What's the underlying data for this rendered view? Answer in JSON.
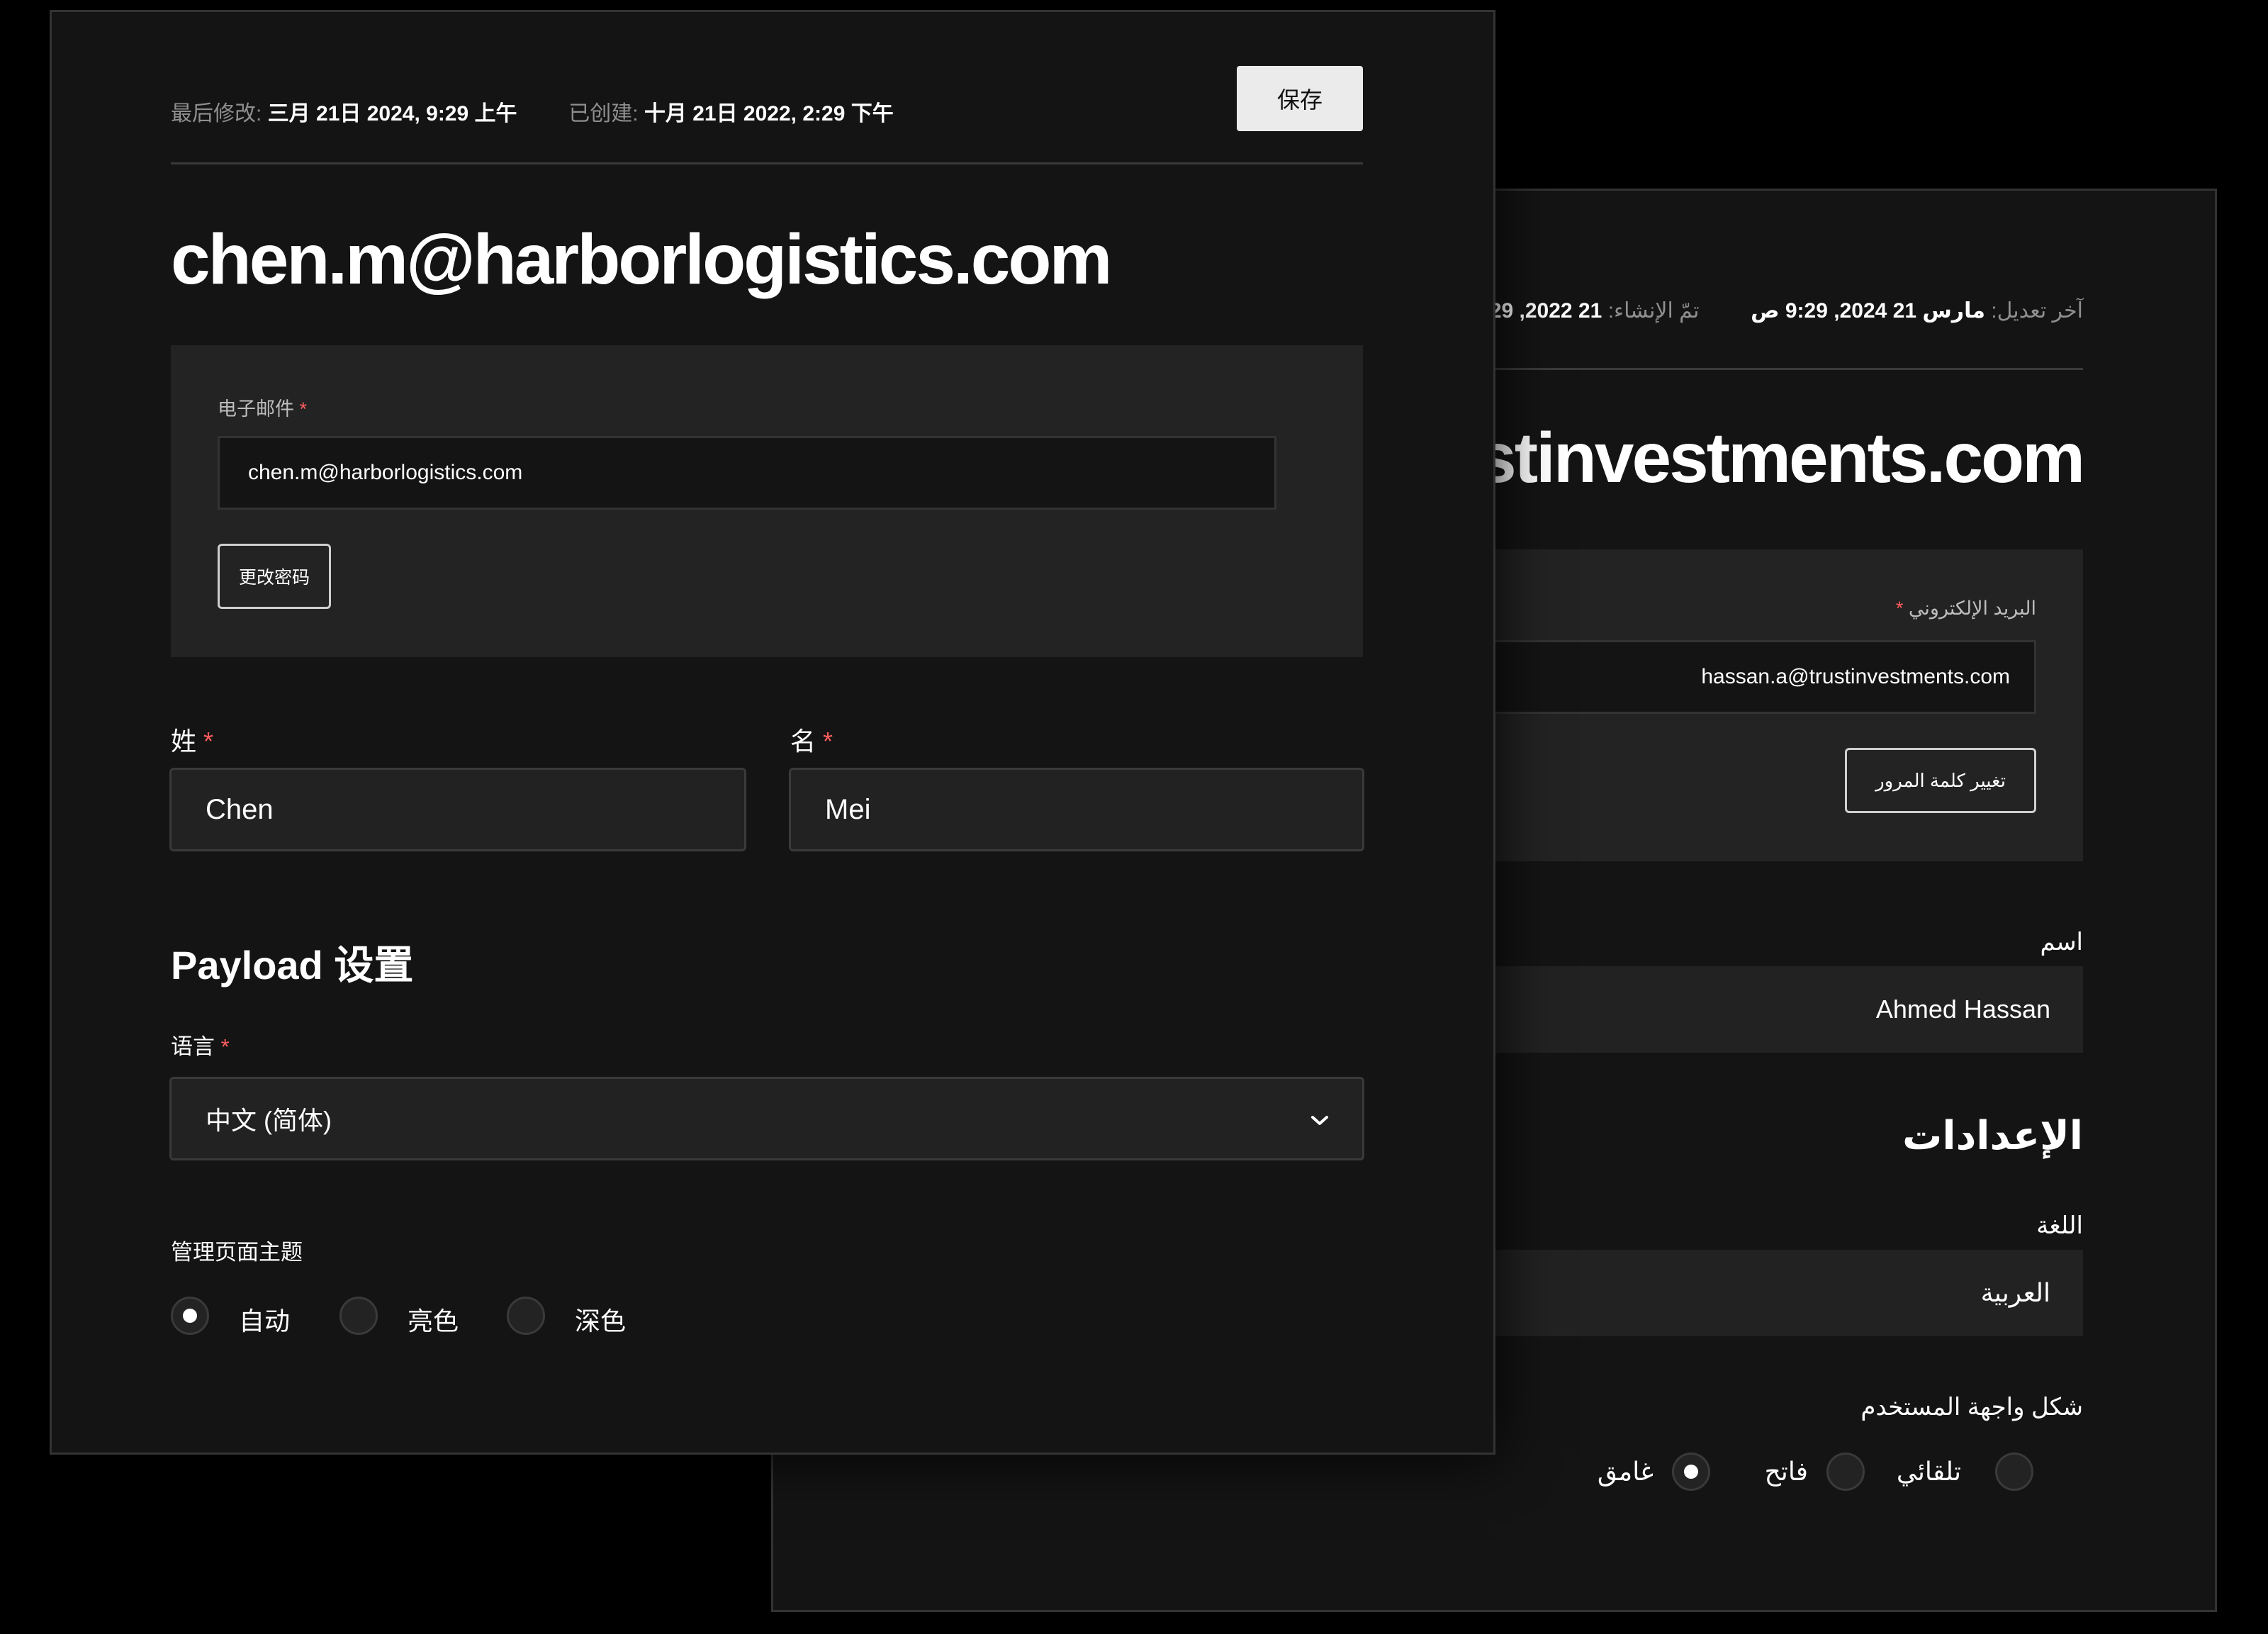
{
  "front": {
    "meta": {
      "modified_label": "最后修改:",
      "modified_value": "三月 21日 2024, 9:29 上午",
      "created_label": "已创建:",
      "created_value": "十月 21日 2022, 2:29 下午"
    },
    "save_label": "保存",
    "title": "chen.m@harborlogistics.com",
    "email": {
      "label": "电子邮件",
      "required_mark": "*",
      "value": "chen.m@harborlogistics.com",
      "change_password_label": "更改密码"
    },
    "last_name": {
      "label": "姓",
      "required_mark": "*",
      "value": "Chen"
    },
    "first_name": {
      "label": "名",
      "required_mark": "*",
      "value": "Mei"
    },
    "settings_heading": "Payload 设置",
    "language": {
      "label": "语言",
      "required_mark": "*",
      "value": "中文 (简体)"
    },
    "theme": {
      "label": "管理页面主题",
      "options": [
        {
          "label": "自动",
          "selected": true
        },
        {
          "label": "亮色",
          "selected": false
        },
        {
          "label": "深色",
          "selected": false
        }
      ]
    }
  },
  "back": {
    "meta": {
      "modified_label": "آخر تعديل:",
      "modified_value": "مارس 21 2024, 9:29 ص",
      "created_label": "تمّ الإنشاء:",
      "created_value": "21 2022, 2:29"
    },
    "title": "hassan.a@trustinvestments.com",
    "email": {
      "label": "البريد الإلكتروني",
      "required_mark": "*",
      "value": "hassan.a@trustinvestments.com",
      "change_password_label": "تغيير كلمة المرور"
    },
    "name": {
      "label": "اسم",
      "value": "Ahmed Hassan"
    },
    "settings_heading": "الإعدادات",
    "language": {
      "label": "اللغة",
      "value": "العربية"
    },
    "theme": {
      "label": "شكل واجهة المستخدم",
      "options": [
        {
          "label": "تلقائي",
          "selected": false
        },
        {
          "label": "فاتح",
          "selected": false
        },
        {
          "label": "غامق",
          "selected": true
        }
      ]
    }
  },
  "colors": {
    "background": "#000000",
    "panel": "#141414",
    "field_box": "#232323",
    "required": "#ff5d5d",
    "save_button": "#ebebeb"
  },
  "icons": {
    "select_caret": "chevron-down-icon"
  }
}
